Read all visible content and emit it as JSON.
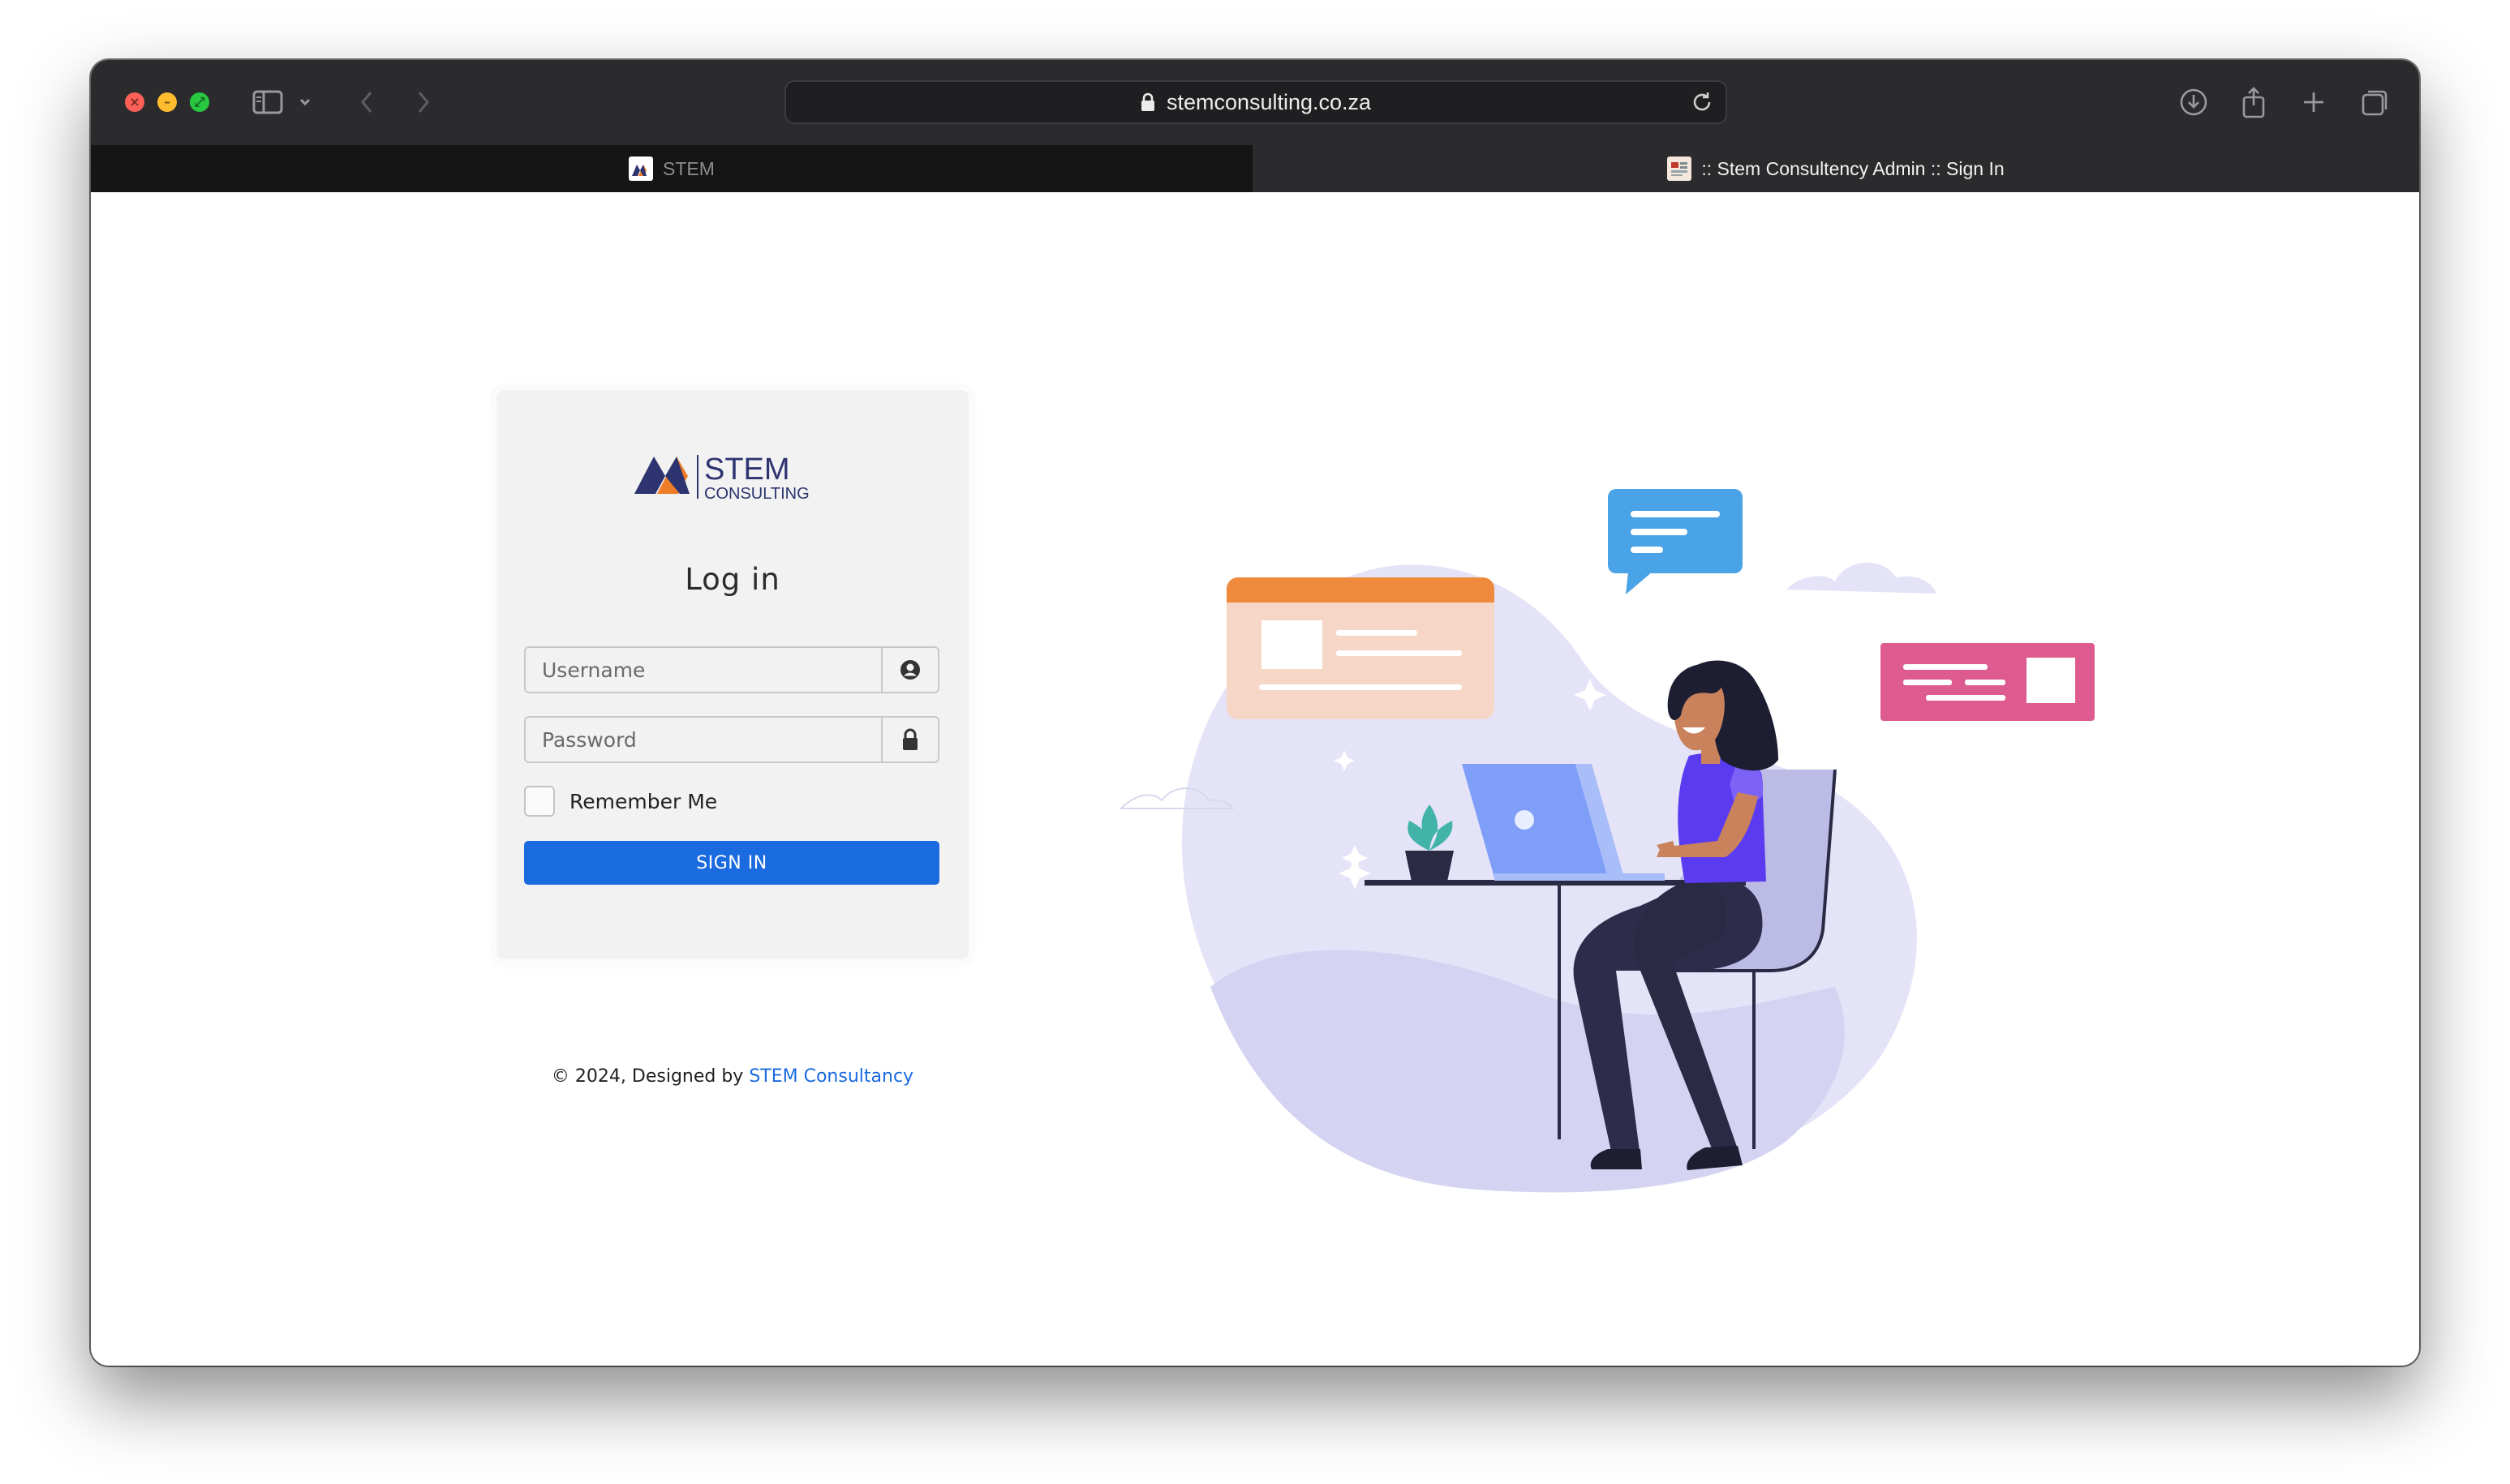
{
  "browser": {
    "url": "stemconsulting.co.za",
    "tabs": [
      {
        "label": "STEM",
        "active": false
      },
      {
        "label": ":: Stem Consultency Admin :: Sign In",
        "active": true
      }
    ]
  },
  "login": {
    "logo_text_top": "STEM",
    "logo_text_bottom": "CONSULTING",
    "title": "Log in",
    "username_placeholder": "Username",
    "password_placeholder": "Password",
    "remember_label": "Remember Me",
    "signin_label": "SIGN IN"
  },
  "footer": {
    "prefix": "© 2024, Designed by ",
    "link_text": "STEM Consultancy"
  },
  "colors": {
    "primary": "#1a6ae0",
    "brand_navy": "#2d3470",
    "brand_orange": "#ef7d27"
  },
  "icons": {
    "username_addon": "user-circle-icon",
    "password_addon": "lock-icon"
  }
}
